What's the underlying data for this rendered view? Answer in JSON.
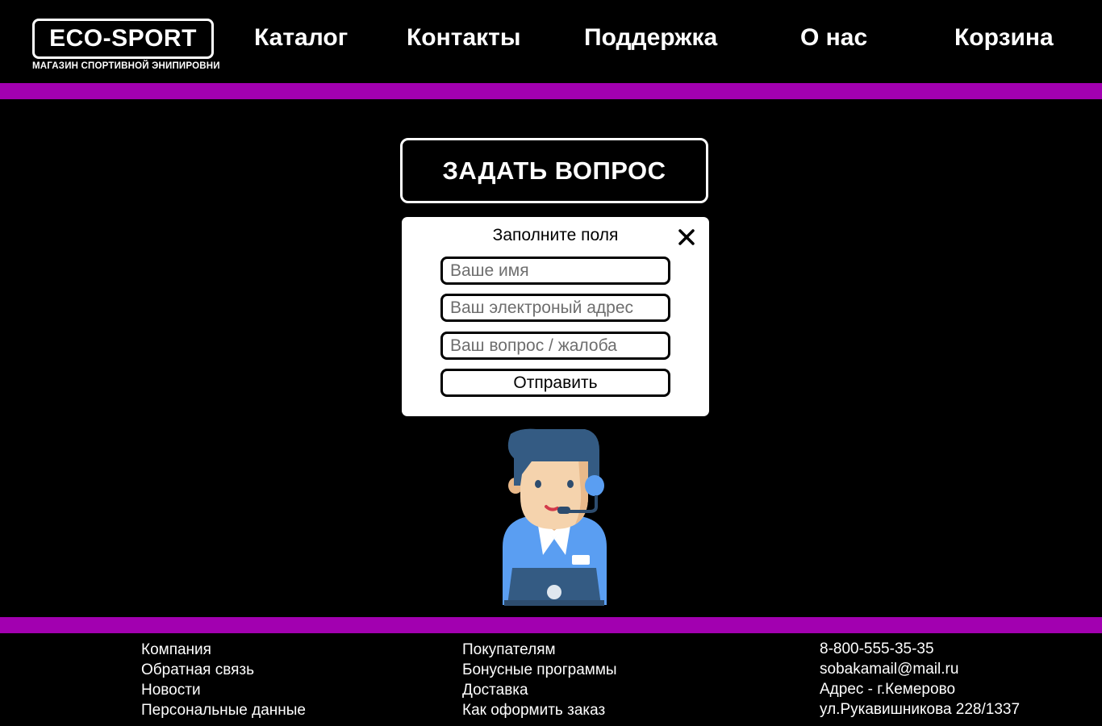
{
  "header": {
    "logo_title": "ECO-SPORT",
    "logo_subtitle": "МАГАЗИН СПОРТИВНОЙ ЭНИПИРОВНИ",
    "nav": [
      "Каталог",
      "Контакты",
      "Поддержка",
      "О нас",
      "Корзина"
    ]
  },
  "colors": {
    "background": "#000000",
    "accent_stripe": "#a200b0",
    "text": "#ffffff"
  },
  "main": {
    "ask_button": "ЗАДАТЬ ВОПРОС",
    "modal": {
      "title": "Заполните поля",
      "close_icon": "close-icon",
      "name_placeholder": "Ваше имя",
      "email_placeholder": "Ваш электроный адрес",
      "question_placeholder": "Ваш вопрос / жалоба",
      "submit_label": "Отправить"
    },
    "illustration": "support-operator-icon"
  },
  "footer": {
    "col1": [
      "Компания",
      "Обратная связь",
      "Новости",
      "Персональные данные"
    ],
    "col2": [
      "Покупателям",
      "Бонусные программы",
      "Доставка",
      "Как оформить заказ"
    ],
    "contacts": [
      "8-800-555-35-35",
      "sobakamail@mail.ru",
      "Адрес - г.Кемерово",
      "ул.Рукавишникова 228/1337"
    ]
  }
}
